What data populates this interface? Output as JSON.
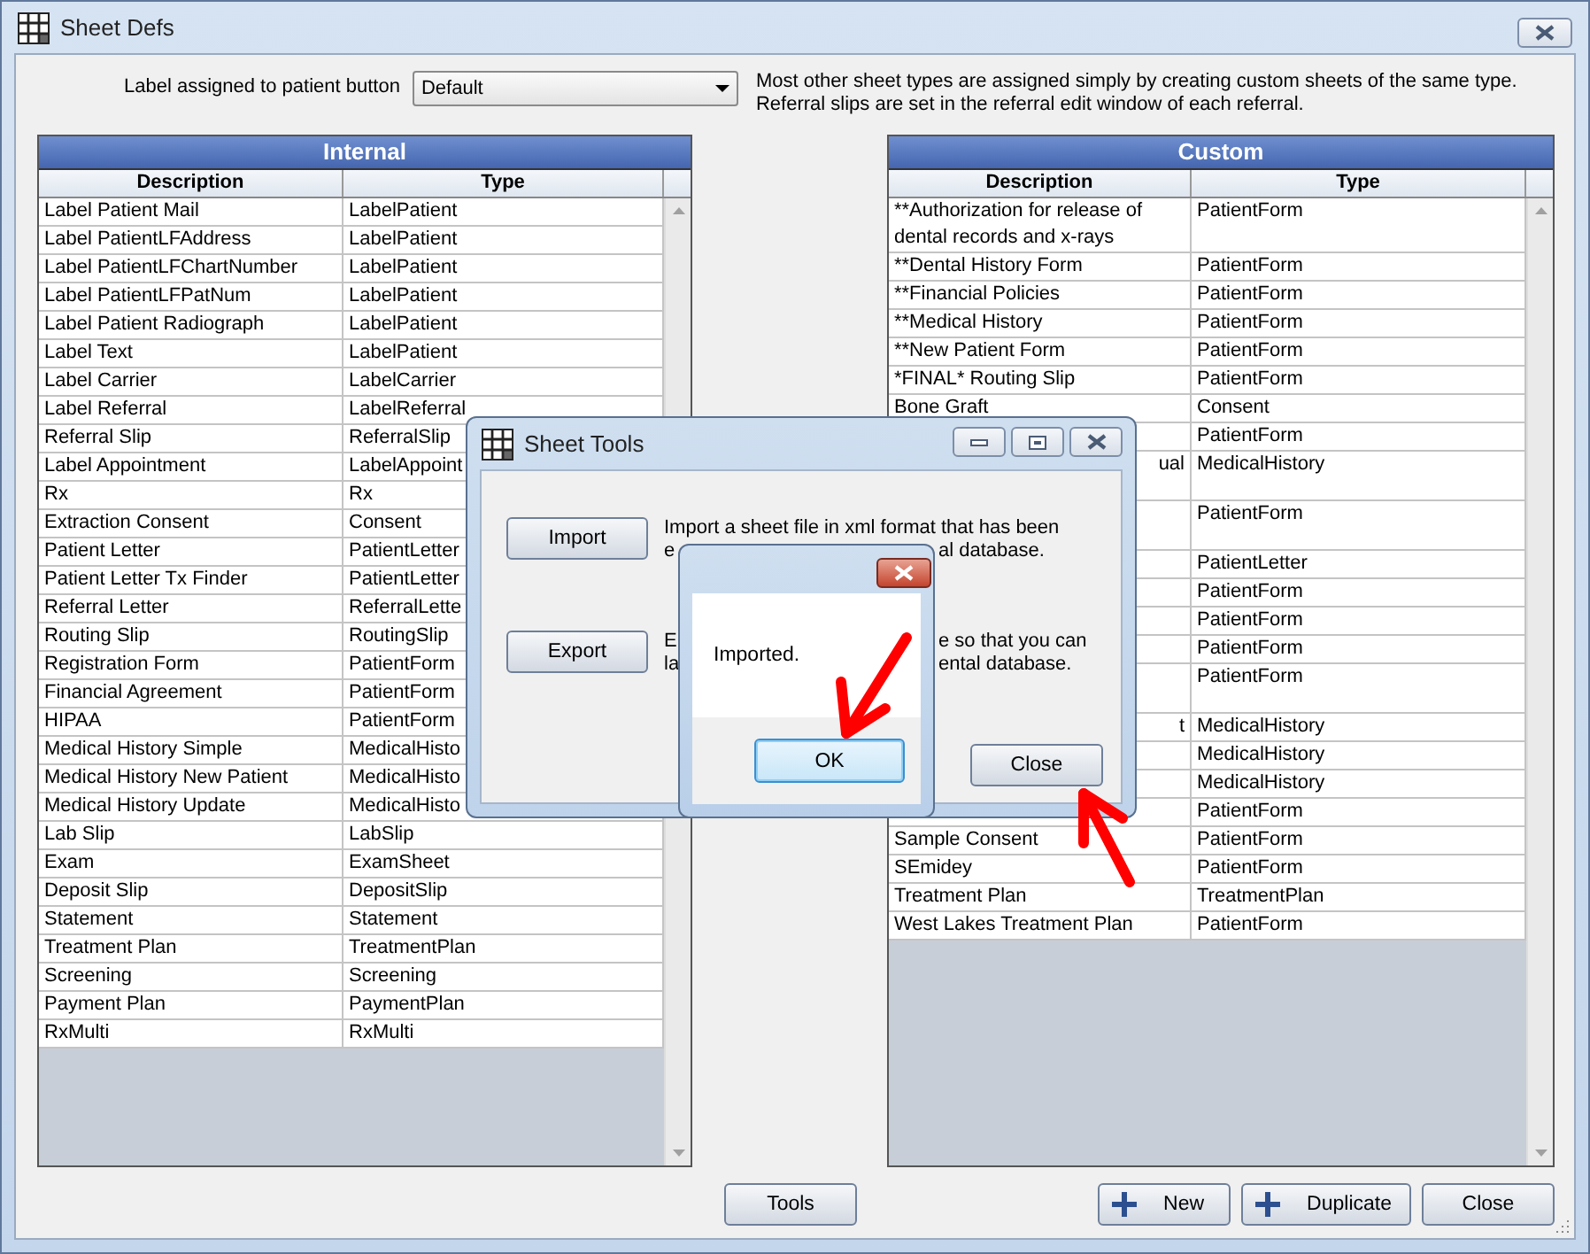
{
  "window": {
    "title": "Sheet Defs"
  },
  "patient_button": {
    "label": "Label assigned to patient button",
    "value": "Default"
  },
  "note_lines": [
    "Most other sheet types are assigned simply by creating custom sheets of the same type.",
    "Referral slips are set in the referral edit window of each referral."
  ],
  "internal": {
    "title": "Internal",
    "columns": [
      "Description",
      "Type"
    ],
    "rows": [
      {
        "description": "Label Patient Mail",
        "type": "LabelPatient"
      },
      {
        "description": "Label PatientLFAddress",
        "type": "LabelPatient"
      },
      {
        "description": "Label PatientLFChartNumber",
        "type": "LabelPatient"
      },
      {
        "description": "Label PatientLFPatNum",
        "type": "LabelPatient"
      },
      {
        "description": "Label Patient Radiograph",
        "type": "LabelPatient"
      },
      {
        "description": "Label Text",
        "type": "LabelPatient"
      },
      {
        "description": "Label Carrier",
        "type": "LabelCarrier"
      },
      {
        "description": "Label Referral",
        "type": "LabelReferral"
      },
      {
        "description": "Referral Slip",
        "type": "ReferralSlip"
      },
      {
        "description": "Label Appointment",
        "type": "LabelAppoint"
      },
      {
        "description": "Rx",
        "type": "Rx"
      },
      {
        "description": "Extraction Consent",
        "type": "Consent"
      },
      {
        "description": "Patient Letter",
        "type": "PatientLetter"
      },
      {
        "description": "Patient Letter Tx Finder",
        "type": "PatientLetter"
      },
      {
        "description": "Referral Letter",
        "type": "ReferralLette"
      },
      {
        "description": "Routing Slip",
        "type": "RoutingSlip"
      },
      {
        "description": "Registration Form",
        "type": "PatientForm"
      },
      {
        "description": "Financial Agreement",
        "type": "PatientForm"
      },
      {
        "description": "HIPAA",
        "type": "PatientForm"
      },
      {
        "description": "Medical History Simple",
        "type": "MedicalHisto"
      },
      {
        "description": "Medical History New Patient",
        "type": "MedicalHisto"
      },
      {
        "description": "Medical History Update",
        "type": "MedicalHisto"
      },
      {
        "description": "Lab Slip",
        "type": "LabSlip"
      },
      {
        "description": "Exam",
        "type": "ExamSheet"
      },
      {
        "description": "Deposit Slip",
        "type": "DepositSlip"
      },
      {
        "description": "Statement",
        "type": "Statement"
      },
      {
        "description": "Treatment Plan",
        "type": "TreatmentPlan"
      },
      {
        "description": "Screening",
        "type": "Screening"
      },
      {
        "description": "Payment Plan",
        "type": "PaymentPlan"
      },
      {
        "description": "RxMulti",
        "type": "RxMulti"
      }
    ]
  },
  "custom": {
    "title": "Custom",
    "columns": [
      "Description",
      "Type"
    ],
    "rows": [
      {
        "description": "**Authorization for release of dental records and x-rays",
        "type": "PatientForm",
        "clipped": false
      },
      {
        "description": "**Dental History Form",
        "type": "PatientForm",
        "clipped": false,
        "tall": false
      },
      {
        "description": "**Financial Policies",
        "type": "PatientForm",
        "clipped": false,
        "tall": false
      },
      {
        "description": "**Medical History",
        "type": "PatientForm",
        "clipped": false,
        "tall": false
      },
      {
        "description": "**New Patient Form",
        "type": "PatientForm",
        "clipped": false,
        "tall": false
      },
      {
        "description": "*FINAL* Routing Slip",
        "type": "PatientForm",
        "clipped": false,
        "tall": false
      },
      {
        "description": "Bone Graft",
        "type": "Consent",
        "clipped": false,
        "tall": false
      },
      {
        "type": "PatientForm",
        "tall": false
      },
      {
        "description": "ual",
        "type": "MedicalHistory",
        "clipped": true,
        "tall": true
      },
      {
        "type": "PatientForm",
        "tall": true
      },
      {
        "type": "PatientLetter",
        "tall": false
      },
      {
        "type": "PatientForm",
        "tall": false
      },
      {
        "type": "PatientForm",
        "tall": false
      },
      {
        "type": "PatientForm",
        "tall": false
      },
      {
        "type": "PatientForm",
        "tall": true
      },
      {
        "description": "t",
        "type": "MedicalHistory",
        "clipped": true,
        "tall": false
      },
      {
        "type": "MedicalHistory",
        "tall": false
      },
      {
        "type": "MedicalHistory",
        "tall": false
      },
      {
        "type": "PatientForm",
        "tall": false
      },
      {
        "description": "Sample Consent",
        "type": "PatientForm",
        "clipped": false,
        "tall": false
      },
      {
        "description": "SEmidey",
        "type": "PatientForm",
        "clipped": false,
        "tall": false
      },
      {
        "description": "Treatment Plan",
        "type": "TreatmentPlan",
        "clipped": false,
        "tall": false
      },
      {
        "description": "West Lakes Treatment Plan",
        "type": "PatientForm",
        "clipped": false,
        "tall": false
      }
    ]
  },
  "tools_button": "Tools",
  "buttons": [
    {
      "label": "New",
      "kind": "add"
    },
    {
      "label": "Duplicate",
      "kind": "add"
    },
    {
      "label": "Close",
      "kind": "plain"
    }
  ],
  "sheet_tools": {
    "title": "Sheet Tools",
    "actions": [
      {
        "button": "Import",
        "lines": [
          [
            "Import a sheet file in xml format that has been"
          ],
          [
            "e",
            "al database."
          ]
        ]
      },
      {
        "button": "Export",
        "lines": [
          [
            "E",
            "e so that you can"
          ],
          [
            "la",
            "ental database."
          ]
        ]
      }
    ],
    "close_button": "Close"
  },
  "message_box": {
    "text": "Imported.",
    "button": {
      "label": "OK",
      "focused": true
    }
  }
}
